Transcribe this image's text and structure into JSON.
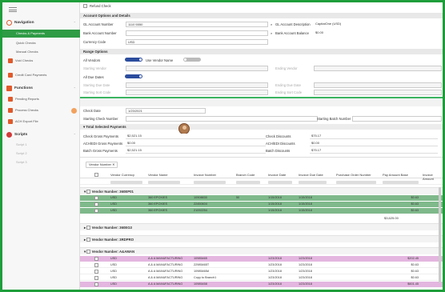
{
  "sidebar": {
    "sections": [
      {
        "label": "Navigation",
        "icon": "compass-icon",
        "color": "#e05a2b"
      },
      {
        "label": "Functions",
        "icon": "functions-icon",
        "color": "#e05a2b"
      },
      {
        "label": "Scripts",
        "icon": "scripts-icon",
        "color": "#d23a3a"
      }
    ],
    "nav_items": [
      "Checks & Payments",
      "Quick Checks",
      "Manual Checks",
      "Void Checks",
      "Credit Card Payments"
    ],
    "function_items": [
      "Pending Reports",
      "Process Checks",
      "ACH Export File"
    ],
    "script_items": [
      "Script 1",
      "Script 2",
      "Script 3"
    ]
  },
  "form": {
    "refund_label": "Refund Check",
    "account_header": "Account Options and Details",
    "gl_account_label": "GL Account Number",
    "gl_account_value": "1110 5550",
    "gl_desc_label": "GL Account Description",
    "gl_desc_value": "CapitalOne (USD)",
    "bank_label": "Bank Account Number",
    "bank_value": "",
    "bank_balance_label": "Bank Account Balance",
    "bank_balance_value": "$0.00",
    "currency_label": "Currency Code",
    "currency_value": "USD",
    "range_header": "Range Options",
    "all_vendors_label": "All Vendors",
    "use_vendor_label": "Use Vendor Name",
    "starting_vendor_label": "Starting Vendor",
    "ending_vendor_label": "Ending Vendor",
    "all_due_label": "All Due Dates",
    "starting_due_label": "Starting Due Date",
    "ending_due_label": "Ending Due Date",
    "starting_sort_label": "Starting Sort Code",
    "ending_sort_label": "Ending Sort Code",
    "check_date_label": "Check Date",
    "check_date_value": "1/23/2021",
    "starting_check_label": "Starting Check Number",
    "starting_batch_label": "Starting Batch Number",
    "totals_header": "Total Selected Payments",
    "check_gross_label": "Check Gross Payments",
    "check_gross_value": "$2,521.15",
    "check_discounts_label": "Check Discounts",
    "check_discounts_value": "$75.17",
    "ach_gross_label": "ACH/EDI Gross Payments",
    "ach_gross_value": "$0.00",
    "ach_disc_label": "ACH/EDI Discounts",
    "ach_disc_value": "$0.00",
    "batch_gross_label": "Batch Gross Payments",
    "batch_gross_value": "$2,521.15",
    "batch_disc_label": "Batch Discounts",
    "batch_disc_value": "$75.17"
  },
  "grid": {
    "group_button": "Vendor Number",
    "columns": [
      "Vendor Currency",
      "Vendor Name",
      "Invoice Number",
      "Branch Code",
      "Invoice Date",
      "Invoice Due Date",
      "Purchase Order Number",
      "Pay Amount Base",
      "Invoice Amount"
    ],
    "groups": [
      {
        "label": "Vendor Number: 360EP01",
        "rows": [
          {
            "currency": "USD",
            "name": "360 EPOXIES",
            "invoice": "10908830",
            "branch": "50",
            "date": "1/15/2018",
            "due": "1/15/2018",
            "amount": "$0.63"
          },
          {
            "currency": "USD",
            "name": "360 EPOXIES",
            "invoice": "22450604",
            "branch": "",
            "date": "1/15/2018",
            "due": "1/15/2018",
            "amount": "$0.63"
          },
          {
            "currency": "USD",
            "name": "360 EPOXIES",
            "invoice": "21092254",
            "branch": "",
            "date": "1/15/2018",
            "due": "1/15/2018",
            "amount": "$0.63"
          }
        ],
        "total": "$3,625.00"
      },
      {
        "label": "Vendor Number: 360EG3"
      },
      {
        "label": "Vendor Number: 3RDPRO"
      },
      {
        "label": "Vendor Number: A&AMAN",
        "rows": [
          {
            "currency": "USD",
            "name": "A & A MANUFACTURING",
            "invoice": "10985465",
            "branch": "",
            "date": "1/23/2018",
            "due": "1/23/2018",
            "amount": "$202.45"
          },
          {
            "currency": "USD",
            "name": "A & A MANUFACTURING",
            "invoice": "22985465T",
            "branch": "",
            "date": "1/23/2018",
            "due": "1/23/2018",
            "amount": "$0.63"
          },
          {
            "currency": "USD",
            "name": "A & A MANUFACTURING",
            "invoice": "10985465A",
            "branch": "",
            "date": "1/23/2018",
            "due": "1/23/2018",
            "amount": "$0.63"
          },
          {
            "currency": "USD",
            "name": "A & A MANUFACTURING",
            "invoice": "Copy to Branch1",
            "branch": "",
            "date": "1/23/2018",
            "due": "1/23/2018",
            "amount": "$0.63"
          },
          {
            "currency": "USD",
            "name": "A & A MANUFACTURING",
            "invoice": "10985458",
            "branch": "",
            "date": "1/23/2018",
            "due": "1/23/2018",
            "amount": "$601.45"
          }
        ]
      }
    ]
  },
  "colors": {
    "accent": "#2e9b45",
    "green_row": "#7fb98b",
    "pink_row": "#e3b6df",
    "toggle": "#2c4d9e"
  }
}
